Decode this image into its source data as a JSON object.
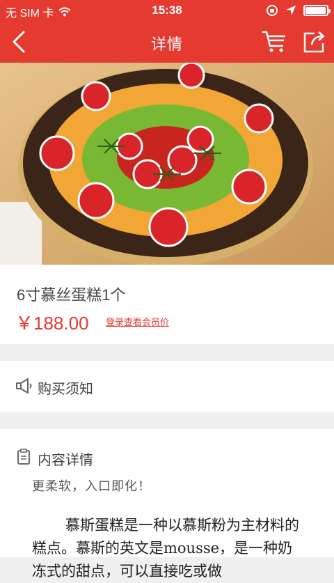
{
  "status_bar": {
    "carrier": "无 SIM 卡",
    "time": "15:38",
    "battery_level": 0.95
  },
  "nav": {
    "title": "详情",
    "icons": [
      "back-arrow-icon",
      "cart-icon",
      "share-icon"
    ]
  },
  "product": {
    "name": "6寸慕丝蛋糕1个",
    "price": "￥188.00",
    "member_link": "登录查看会员价"
  },
  "notice": {
    "label": "购买须知",
    "icon": "megaphone-icon"
  },
  "details": {
    "label": "内容详情",
    "icon": "clipboard-icon",
    "subtitle": "更柔软，入口即化！",
    "body": "慕斯蛋糕是一种以慕斯粉为主材料的糕点。慕斯的英文是mousse，是一种奶冻式的甜点，可以直接吃或做"
  },
  "colors": {
    "accent": "#e53a30",
    "background": "#f0f0f0",
    "card": "#ffffff"
  }
}
